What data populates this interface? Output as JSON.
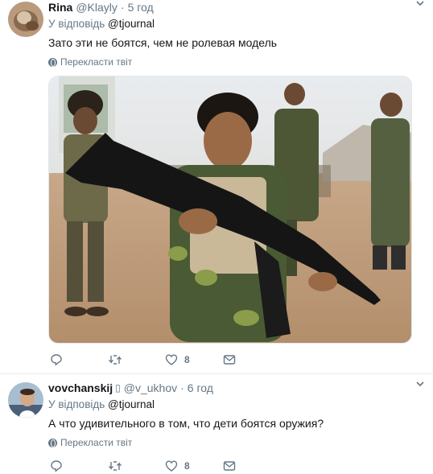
{
  "tweets": [
    {
      "name": "Rina",
      "verified_mark": "",
      "handle": "@Klayly",
      "separator": "·",
      "time": "5 год",
      "reply_prefix": "У відповідь",
      "reply_mention": "@tjournal",
      "text": "Зато эти не боятся, чем не ролевая модель",
      "translate_label": "Перекласти твіт",
      "likes": "8",
      "has_media": true
    },
    {
      "name": "vovchanskij",
      "verified_mark": "▯",
      "handle": "@v_ukhov",
      "separator": "·",
      "time": "6 год",
      "reply_prefix": "У відповідь",
      "reply_mention": "@tjournal",
      "text": "А что удивительного в том, что дети боятся оружия?",
      "translate_label": "Перекласти твіт",
      "likes": "8",
      "has_media": false
    }
  ],
  "icons": {
    "reply": "reply-icon",
    "retweet": "retweet-icon",
    "like": "heart-icon",
    "dm": "envelope-icon",
    "caret": "chevron-down-icon",
    "translate": "globe-icon"
  },
  "colors": {
    "text": "#14171a",
    "secondary": "#657786",
    "divider": "#e6ecf0"
  }
}
